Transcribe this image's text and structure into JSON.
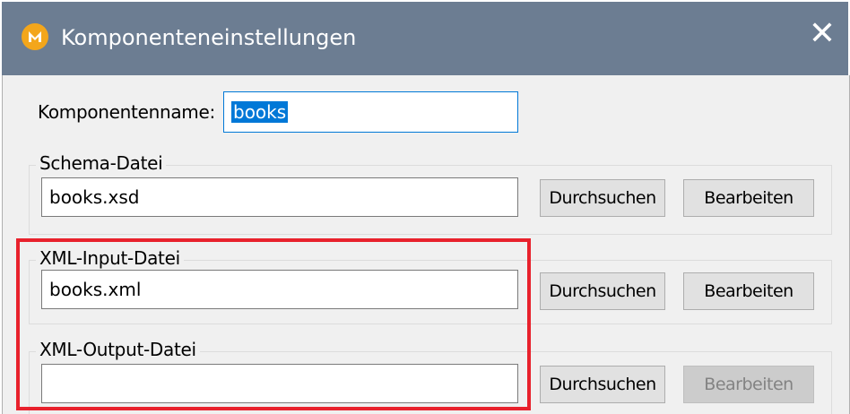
{
  "window": {
    "title": "Komponenteneinstellungen",
    "close_glyph": "✕",
    "app_icon": "altova-mapforce-icon"
  },
  "component": {
    "label": "Komponentenname:",
    "value": "books"
  },
  "schema": {
    "group_label": "Schema-Datei",
    "value": "books.xsd",
    "browse_label": "Durchsuchen",
    "edit_label": "Bearbeiten"
  },
  "xml_input": {
    "group_label": "XML-Input-Datei",
    "value": "books.xml",
    "browse_label": "Durchsuchen",
    "edit_label": "Bearbeiten"
  },
  "xml_output": {
    "group_label": "XML-Output-Datei",
    "value": "",
    "browse_label": "Durchsuchen",
    "edit_label": "Bearbeiten",
    "edit_disabled": true
  },
  "colors": {
    "titlebar": "#6c7d92",
    "highlight": "#e8212c",
    "selection": "#0078d7"
  }
}
